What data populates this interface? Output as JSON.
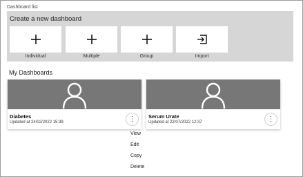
{
  "page": {
    "label": "Dashboard list"
  },
  "create": {
    "title": "Create a new dashboard",
    "tiles": [
      {
        "label": "Individual",
        "icon": "plus-icon"
      },
      {
        "label": "Multiple",
        "icon": "plus-icon"
      },
      {
        "label": "Group",
        "icon": "plus-icon"
      },
      {
        "label": "Import",
        "icon": "import-icon"
      }
    ]
  },
  "my_dashboards": {
    "title": "My Dashboards",
    "cards": [
      {
        "title": "Diabetes",
        "updated": "Updated at 24/02/2022 15:39",
        "icon": "user-avatar-icon"
      },
      {
        "title": "Serum Urate",
        "updated": "Updated at 22/07/2022 12:37",
        "icon": "user-avatar-icon"
      }
    ]
  },
  "context_menu": {
    "items": [
      "View",
      "Edit",
      "Copy",
      "Delete"
    ]
  },
  "colors": {
    "panel_bg": "#d6d6d6",
    "banner_bg": "#777777",
    "tile_bg": "#ffffff"
  }
}
